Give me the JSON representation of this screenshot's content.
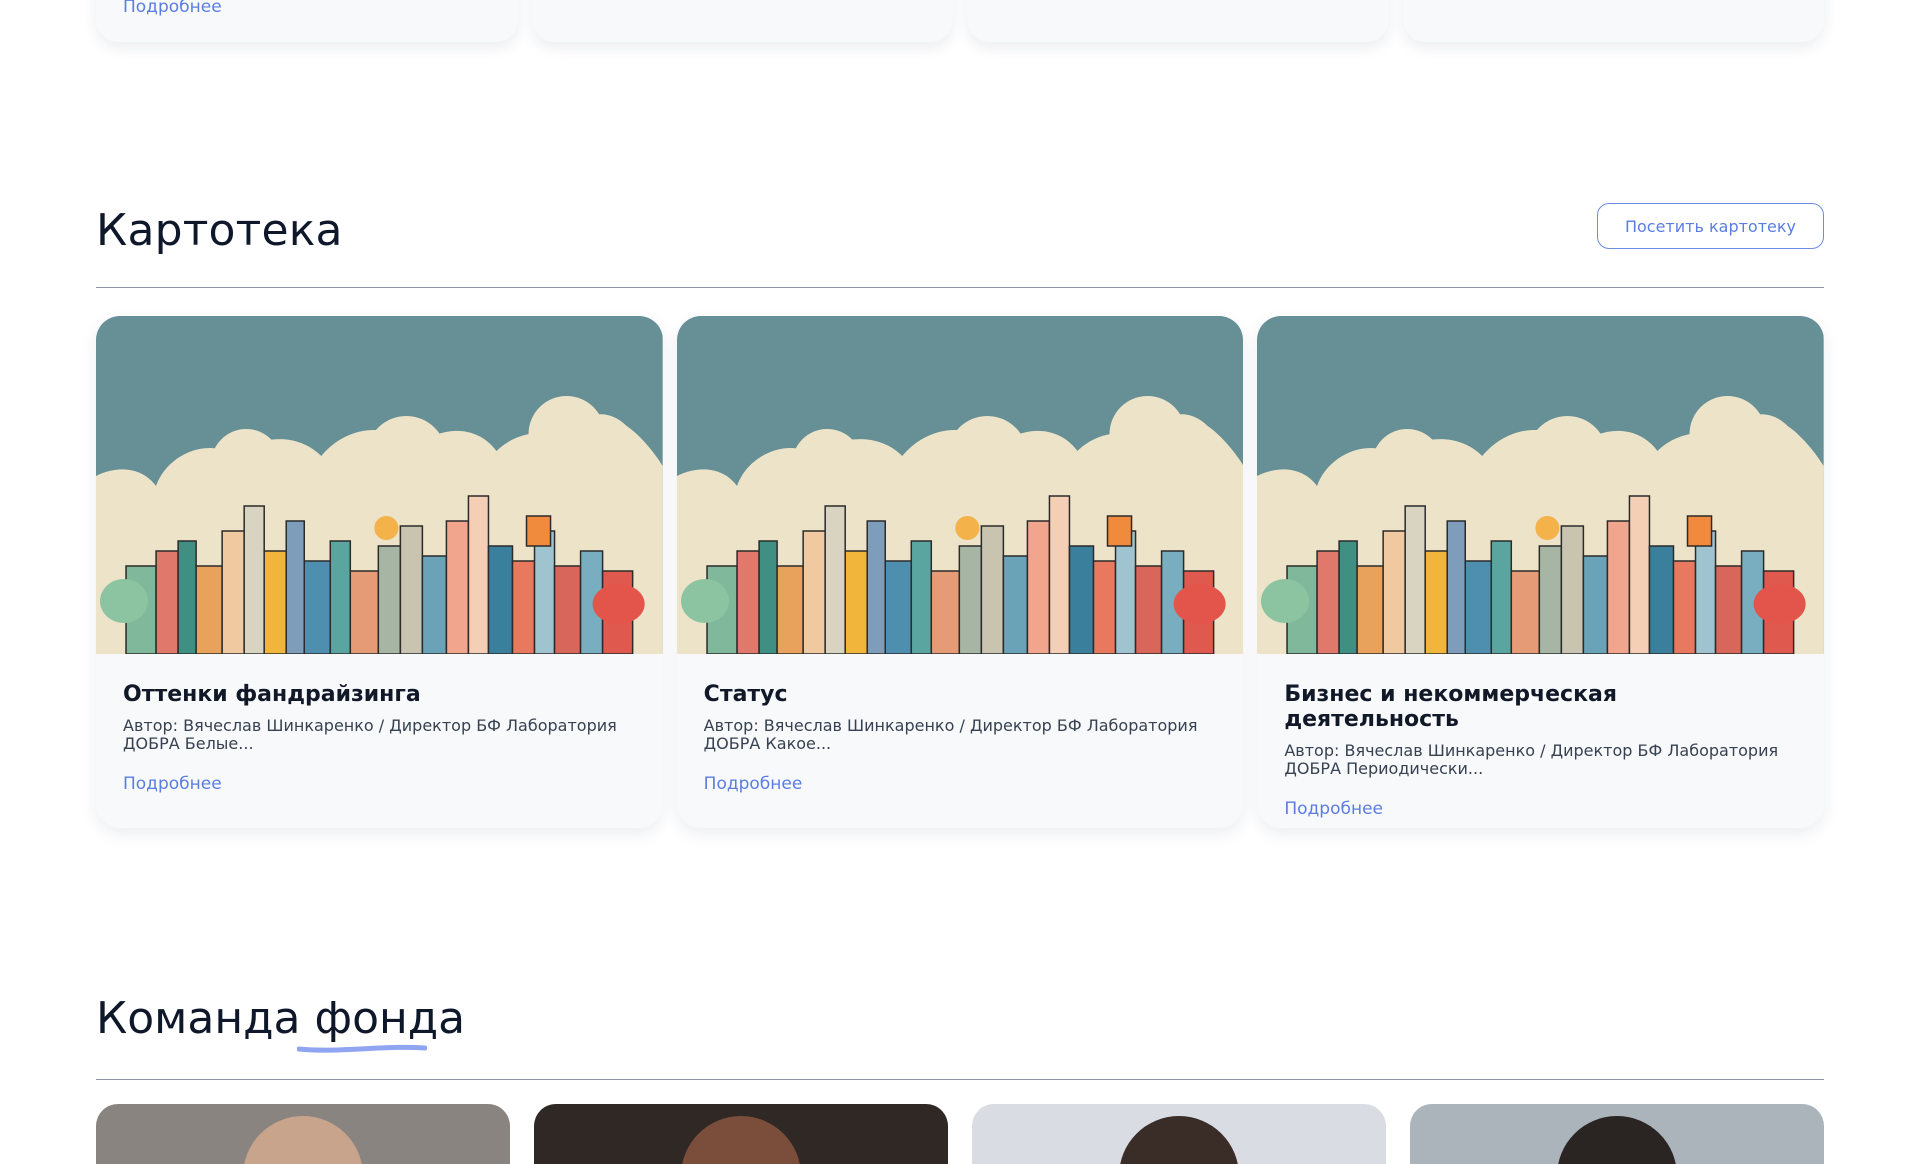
{
  "top_cards": {
    "more_label": "Подробнее"
  },
  "kartoteka": {
    "title": "Картотека",
    "visit_label": "Посетить картотеку",
    "cards": [
      {
        "title": "Оттенки фандрайзинга",
        "excerpt": "Автор: Вячеслав Шинкаренко / Директор БФ Лаборатория ДОБРА   Белые...",
        "more": "Подробнее"
      },
      {
        "title": "Статус",
        "excerpt": "Автор: Вячеслав Шинкаренко / Директор БФ Лаборатория ДОБРА   Какое...",
        "more": "Подробнее"
      },
      {
        "title": "Бизнес и некоммерческая деятельность",
        "excerpt": "Автор: Вячеслав Шинкаренко / Директор БФ Лаборатория ДОБРА   Периодически...",
        "more": "Подробнее"
      }
    ]
  },
  "team": {
    "title": "Команда фонда"
  },
  "colors": {
    "accent": "#5b7de2",
    "sky": "#668f96",
    "cloud": "#ece3c8"
  }
}
